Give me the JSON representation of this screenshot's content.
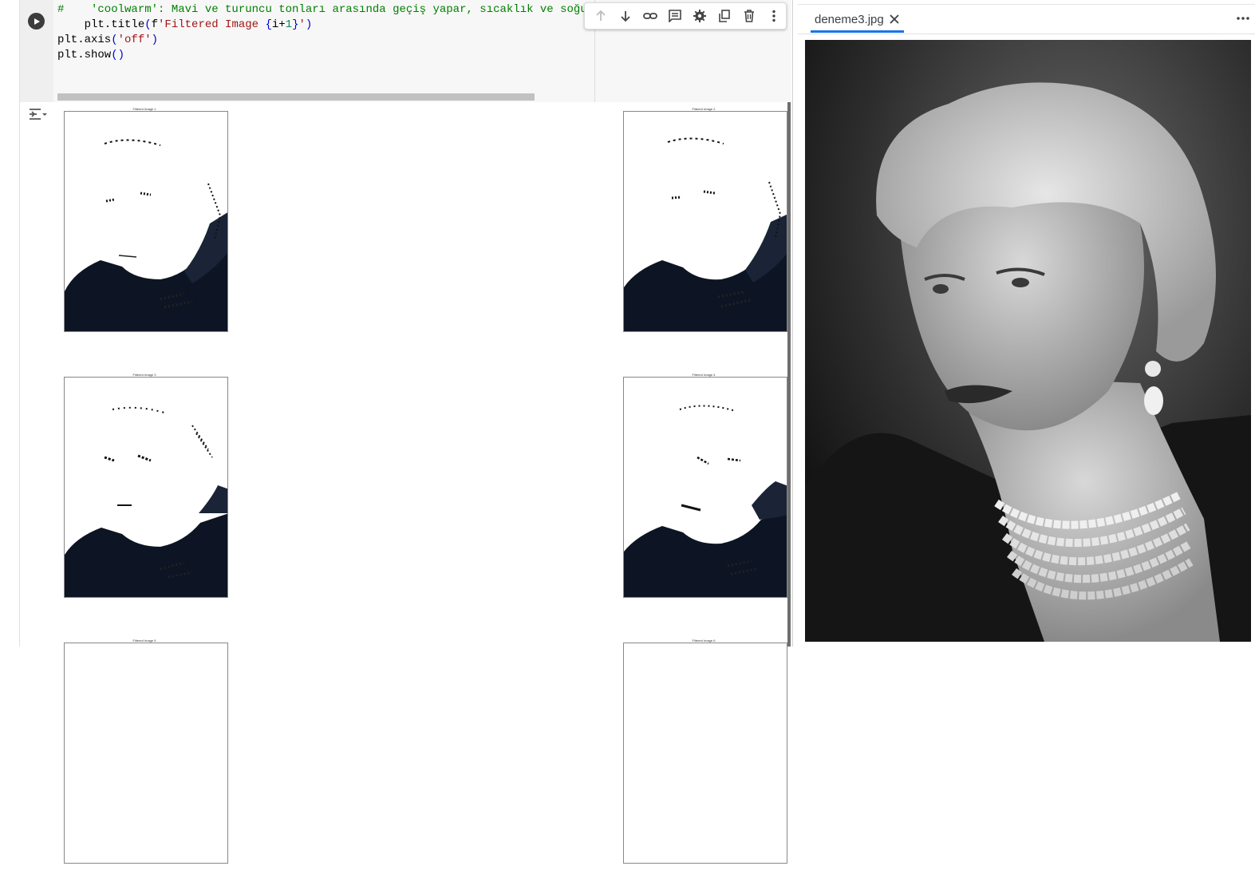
{
  "notebook": {
    "code_lines": [
      "#    'coolwarm': Mavi ve turuncu tonları arasında geçiş yapar, sıcaklık ve soğu",
      "    plt.title(f'Filtered Image {i+1}')",
      "plt.axis('off')",
      "plt.show()"
    ],
    "toolbar_icons": [
      "arrow-up-icon",
      "arrow-down-icon",
      "link-icon",
      "comment-icon",
      "gear-icon",
      "mirror-cell-icon",
      "delete-icon",
      "more-vertical-icon"
    ],
    "figure_titles": [
      "Filtered Image 1",
      "Filtered Image 2",
      "Filtered Image 3",
      "Filtered Image 4",
      "Filtered Image 5",
      "Filtered Image 6"
    ]
  },
  "viewer": {
    "tab_label": "deneme3.jpg"
  },
  "colors": {
    "tab_accent": "#1a73e8",
    "code_bg": "#f7f7f7",
    "comment": "#008000",
    "string": "#a31515"
  }
}
